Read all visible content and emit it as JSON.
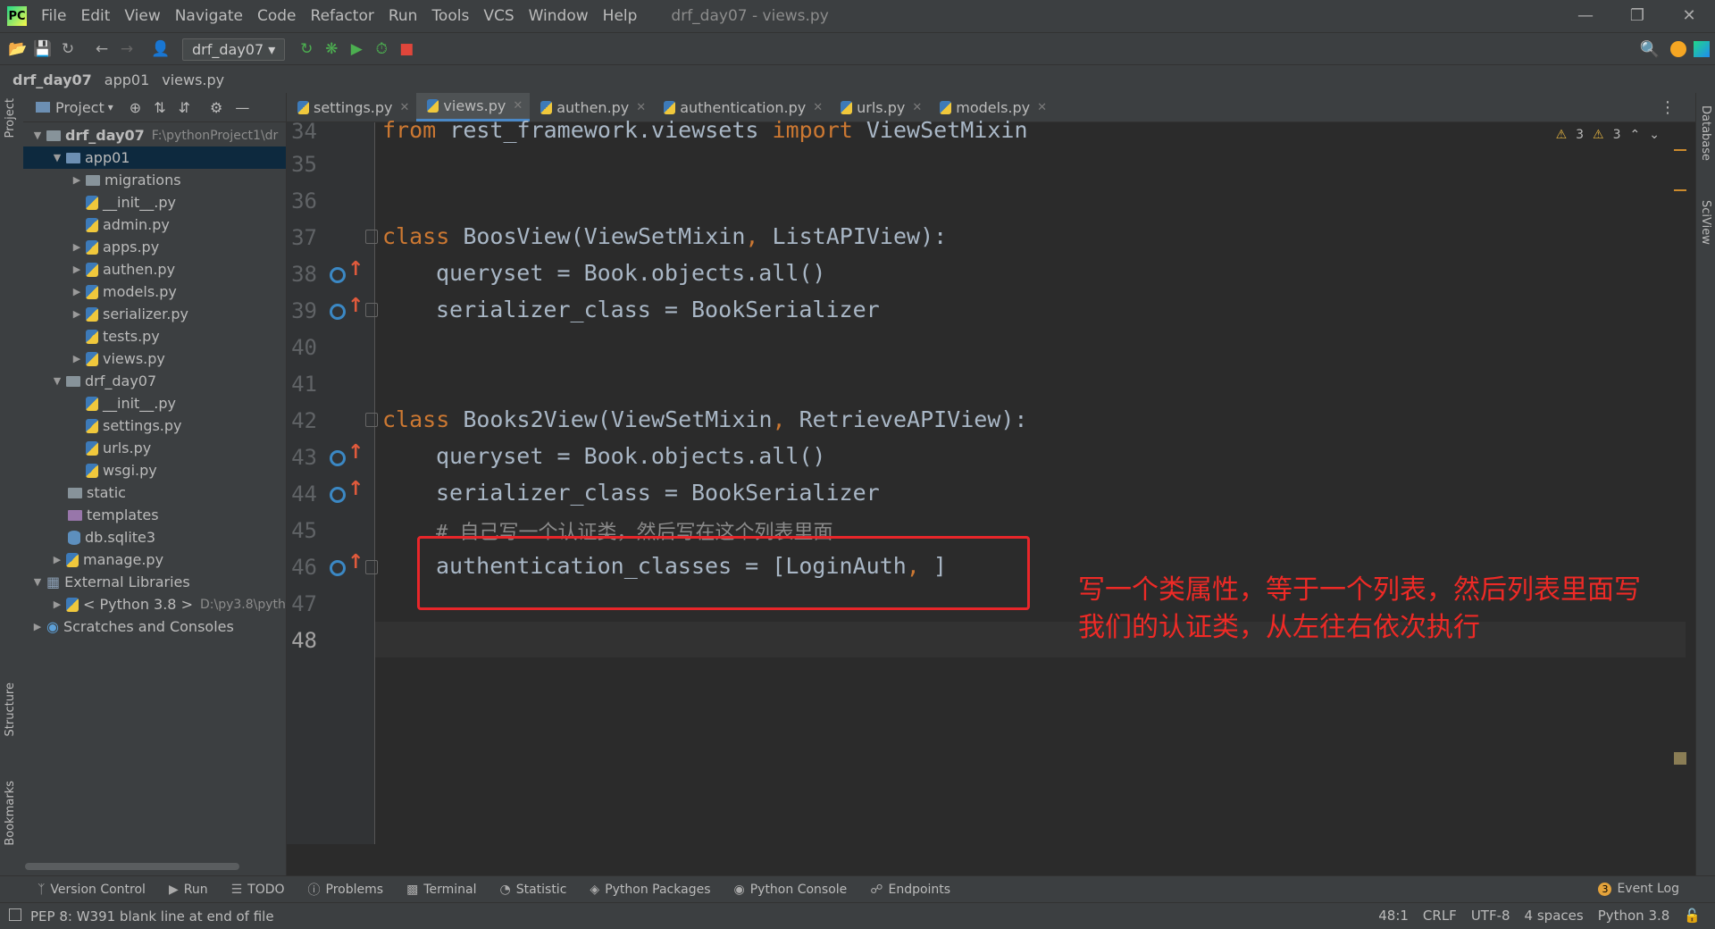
{
  "titlebar": {
    "menu": [
      "File",
      "Edit",
      "View",
      "Navigate",
      "Code",
      "Refactor",
      "Run",
      "Tools",
      "VCS",
      "Window",
      "Help"
    ],
    "window_title": "drf_day07 - views.py"
  },
  "toolbar": {
    "run_config": "drf_day07"
  },
  "breadcrumb": [
    "drf_day07",
    "app01",
    "views.py"
  ],
  "leftstrip": {
    "project": "Project",
    "structure": "Structure",
    "bookmarks": "Bookmarks"
  },
  "project_panel": {
    "title": "Project",
    "root_name": "drf_day07",
    "root_path": "F:\\pythonProject1\\dr",
    "items": [
      "app01",
      "migrations",
      "__init__.py",
      "admin.py",
      "apps.py",
      "authen.py",
      "models.py",
      "serializer.py",
      "tests.py",
      "views.py",
      "drf_day07",
      "__init__.py",
      "settings.py",
      "urls.py",
      "wsgi.py",
      "static",
      "templates",
      "db.sqlite3",
      "manage.py",
      "External Libraries",
      "< Python 3.8 >",
      "Scratches and Consoles"
    ],
    "python_path": "D:\\py3.8\\pyth"
  },
  "tabs": [
    "settings.py",
    "views.py",
    "authen.py",
    "authentication.py",
    "urls.py",
    "models.py"
  ],
  "editor": {
    "line_numbers": [
      "34",
      "35",
      "36",
      "37",
      "38",
      "39",
      "40",
      "41",
      "42",
      "43",
      "44",
      "45",
      "46",
      "47",
      "48"
    ],
    "lines": {
      "l34a": "from",
      "l34b": " rest_framework.viewsets ",
      "l34c": "import",
      "l34d": " ViewSetMixin",
      "l37a": "class",
      "l37b": " BoosView(ViewSetMixin",
      "l37c": ",",
      "l37d": " ListAPIView):",
      "l38": "queryset = Book.objects.all()",
      "l39": "serializer_class = BookSerializer",
      "l42a": "class",
      "l42b": " Books2View(ViewSetMixin",
      "l42c": ",",
      "l42d": " RetrieveAPIView):",
      "l43": "queryset = Book.objects.all()",
      "l44": "serializer_class = BookSerializer",
      "l45": "# 自己写一个认证类，然后写在这个列表里面",
      "l46a": "authentication_classes = [LoginAuth",
      "l46b": ",",
      "l46c": " ]"
    },
    "inspections": {
      "warn1": "3",
      "warn2": "3"
    }
  },
  "annotation": {
    "line1": "写一个类属性，等于一个列表，然后列表里面写",
    "line2": "我们的认证类，从左往右依次执行"
  },
  "rightstrip": {
    "database": "Database",
    "sciview": "SciView"
  },
  "bottom_tools": [
    "Version Control",
    "Run",
    "TODO",
    "Problems",
    "Terminal",
    "Statistic",
    "Python Packages",
    "Python Console",
    "Endpoints"
  ],
  "event_log": {
    "label": "Event Log",
    "count": "3"
  },
  "status": {
    "message": "PEP 8: W391 blank line at end of file",
    "position": "48:1",
    "line_sep": "CRLF",
    "encoding": "UTF-8",
    "indent": "4 spaces",
    "interpreter": "Python 3.8"
  }
}
